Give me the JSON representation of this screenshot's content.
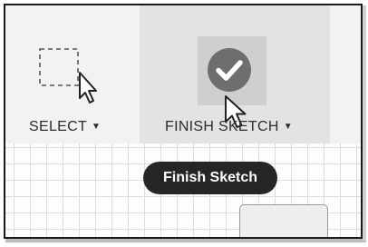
{
  "toolbar": {
    "select": {
      "label": "SELECT",
      "icon": "select-window-icon",
      "dropdown_icon": "caret-down-icon"
    },
    "finish_sketch": {
      "label": "FINISH SKETCH",
      "icon": "checkmark-icon",
      "dropdown_icon": "caret-down-icon",
      "state": "hovered"
    }
  },
  "tooltip": {
    "text": "Finish Sketch"
  },
  "cursors": [
    "arrow-pointer-icon",
    "arrow-pointer-icon"
  ],
  "colors": {
    "toolbar_bg": "#f2f2f2",
    "active_button_bg": "#e3e3e3",
    "icon_circle": "#6e6e6e",
    "tooltip_bg": "#262626",
    "tooltip_text": "#ffffff",
    "grid_line": "#dcdcdc"
  }
}
